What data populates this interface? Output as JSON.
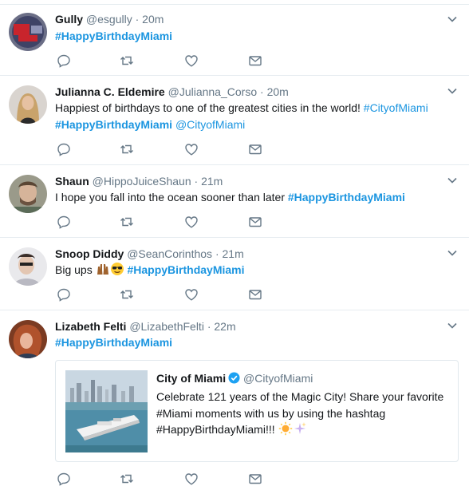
{
  "tweets": [
    {
      "name": "Gully",
      "handle": "@esgully",
      "time": "20m",
      "hashtag": "#HappyBirthdayMiami"
    },
    {
      "name": "Julianna C. Eldemire",
      "handle": "@Julianna_Corso",
      "time": "20m",
      "text_line1": "Happiest of birthdays to one of the greatest cities in the world! ",
      "tag1": "#CityofMiami",
      "tag2": "#HappyBirthdayMiami",
      "mention": "@CityofMiami"
    },
    {
      "name": "Shaun",
      "handle": "@HippoJuiceShaun",
      "time": "21m",
      "text": "I hope you fall into the ocean sooner than later ",
      "hashtag": "#HappyBirthdayMiami"
    },
    {
      "name": "Snoop Diddy",
      "handle": "@SeanCorinthos",
      "time": "21m",
      "text": "Big ups",
      "hashtag": "#HappyBirthdayMiami"
    },
    {
      "name": "Lizabeth Felti",
      "handle": "@LizabethFelti",
      "time": "22m",
      "hashtag": "#HappyBirthdayMiami",
      "quote": {
        "name": "City of Miami",
        "handle": "@CityofMiami",
        "line1": "Celebrate 121 years of the Magic City! Share your favorite",
        "line2": "#Miami moments with us by using the hashtag",
        "line3": "#HappyBirthdayMiami!!! "
      }
    }
  ],
  "separator": "·",
  "colors": {
    "link": "#1b95e0",
    "secondary": "#657786",
    "border": "#e6ecf0",
    "icon": "#657786"
  },
  "icons": [
    "reply-icon",
    "retweet-icon",
    "like-icon",
    "direct-message-icon",
    "chevron-down-icon",
    "verified-badge-icon"
  ]
}
